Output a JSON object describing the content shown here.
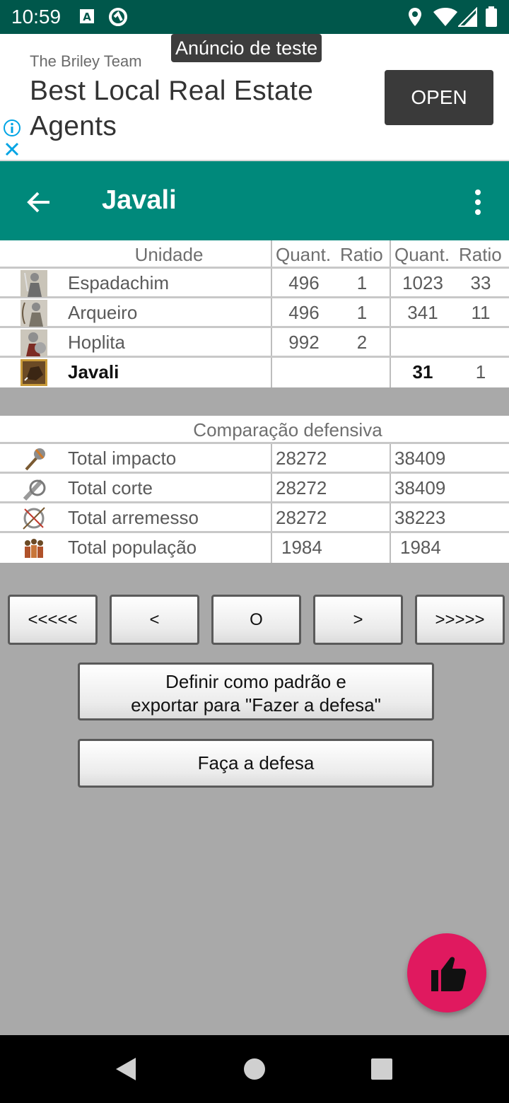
{
  "status_bar": {
    "time": "10:59"
  },
  "ad": {
    "badge": "Anúncio de teste",
    "advertiser": "The Briley Team",
    "headline": "Best Local Real Estate Agents",
    "cta": "OPEN"
  },
  "app_bar": {
    "title": "Javali"
  },
  "units_table": {
    "header": {
      "unit": "Unidade",
      "qty_a": "Quant.",
      "ratio_a": "Ratio",
      "qty_b": "Quant.",
      "ratio_b": "Ratio"
    },
    "rows": [
      {
        "name": "Espadachim",
        "qty_a": "496",
        "ratio_a": "1",
        "qty_b": "1023",
        "ratio_b": "33"
      },
      {
        "name": "Arqueiro",
        "qty_a": "496",
        "ratio_a": "1",
        "qty_b": "341",
        "ratio_b": "11"
      },
      {
        "name": "Hoplita",
        "qty_a": "992",
        "ratio_a": "2",
        "qty_b": "",
        "ratio_b": ""
      },
      {
        "name": "Javali",
        "qty_a": "",
        "ratio_a": "",
        "qty_b": "31",
        "ratio_b": "1"
      }
    ]
  },
  "defense_table": {
    "title": "Comparação defensiva",
    "rows": [
      {
        "label": "Total impacto",
        "a": "28272",
        "b": "38409"
      },
      {
        "label": "Total corte",
        "a": "28272",
        "b": "38409"
      },
      {
        "label": "Total arremesso",
        "a": "28272",
        "b": "38223"
      },
      {
        "label": "Total população",
        "a": "1984",
        "b": "1984"
      }
    ]
  },
  "nav_buttons": {
    "first": "<<<<<",
    "prev": "<",
    "reset": "O",
    "next": ">",
    "last": ">>>>>"
  },
  "actions": {
    "set_default_line1": "Definir como padrão e",
    "set_default_line2": "exportar para \"Fazer a defesa\"",
    "do_defense": "Faça a defesa"
  }
}
